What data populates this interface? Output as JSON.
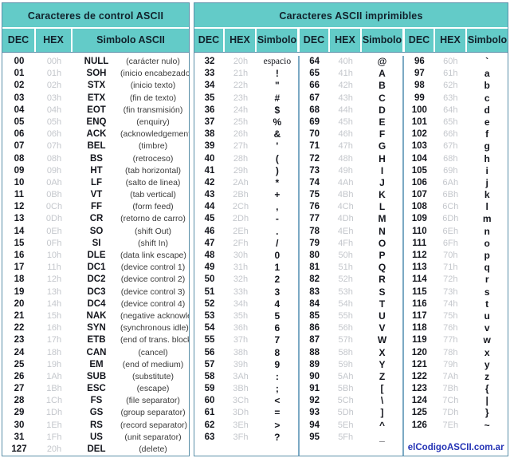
{
  "control_panel": {
    "title": "Caracteres de control ASCII",
    "headers": {
      "dec": "DEC",
      "hex": "HEX",
      "symbol": "Simbolo ASCII"
    },
    "rows": [
      {
        "dec": "00",
        "hex": "00h",
        "sym": "NULL",
        "desc": "(carácter nulo)"
      },
      {
        "dec": "01",
        "hex": "01h",
        "sym": "SOH",
        "desc": "(inicio encabezado)"
      },
      {
        "dec": "02",
        "hex": "02h",
        "sym": "STX",
        "desc": "(inicio texto)"
      },
      {
        "dec": "03",
        "hex": "03h",
        "sym": "ETX",
        "desc": "(fin de texto)"
      },
      {
        "dec": "04",
        "hex": "04h",
        "sym": "EOT",
        "desc": "(fin transmisión)"
      },
      {
        "dec": "05",
        "hex": "05h",
        "sym": "ENQ",
        "desc": "(enquiry)"
      },
      {
        "dec": "06",
        "hex": "06h",
        "sym": "ACK",
        "desc": "(acknowledgement)"
      },
      {
        "dec": "07",
        "hex": "07h",
        "sym": "BEL",
        "desc": "(timbre)"
      },
      {
        "dec": "08",
        "hex": "08h",
        "sym": "BS",
        "desc": "(retroceso)"
      },
      {
        "dec": "09",
        "hex": "09h",
        "sym": "HT",
        "desc": "(tab horizontal)"
      },
      {
        "dec": "10",
        "hex": "0Ah",
        "sym": "LF",
        "desc": "(salto de linea)"
      },
      {
        "dec": "11",
        "hex": "0Bh",
        "sym": "VT",
        "desc": "(tab vertical)"
      },
      {
        "dec": "12",
        "hex": "0Ch",
        "sym": "FF",
        "desc": "(form feed)"
      },
      {
        "dec": "13",
        "hex": "0Dh",
        "sym": "CR",
        "desc": "(retorno de carro)"
      },
      {
        "dec": "14",
        "hex": "0Eh",
        "sym": "SO",
        "desc": "(shift Out)"
      },
      {
        "dec": "15",
        "hex": "0Fh",
        "sym": "SI",
        "desc": "(shift In)"
      },
      {
        "dec": "16",
        "hex": "10h",
        "sym": "DLE",
        "desc": "(data link escape)"
      },
      {
        "dec": "17",
        "hex": "11h",
        "sym": "DC1",
        "desc": "(device control 1)"
      },
      {
        "dec": "18",
        "hex": "12h",
        "sym": "DC2",
        "desc": "(device control 2)"
      },
      {
        "dec": "19",
        "hex": "13h",
        "sym": "DC3",
        "desc": "(device control 3)"
      },
      {
        "dec": "20",
        "hex": "14h",
        "sym": "DC4",
        "desc": "(device control 4)"
      },
      {
        "dec": "21",
        "hex": "15h",
        "sym": "NAK",
        "desc": "(negative acknowle.)"
      },
      {
        "dec": "22",
        "hex": "16h",
        "sym": "SYN",
        "desc": "(synchronous idle)"
      },
      {
        "dec": "23",
        "hex": "17h",
        "sym": "ETB",
        "desc": "(end of trans. block)"
      },
      {
        "dec": "24",
        "hex": "18h",
        "sym": "CAN",
        "desc": "(cancel)"
      },
      {
        "dec": "25",
        "hex": "19h",
        "sym": "EM",
        "desc": "(end of medium)"
      },
      {
        "dec": "26",
        "hex": "1Ah",
        "sym": "SUB",
        "desc": "(substitute)"
      },
      {
        "dec": "27",
        "hex": "1Bh",
        "sym": "ESC",
        "desc": "(escape)"
      },
      {
        "dec": "28",
        "hex": "1Ch",
        "sym": "FS",
        "desc": "(file separator)"
      },
      {
        "dec": "29",
        "hex": "1Dh",
        "sym": "GS",
        "desc": "(group separator)"
      },
      {
        "dec": "30",
        "hex": "1Eh",
        "sym": "RS",
        "desc": "(record separator)"
      },
      {
        "dec": "31",
        "hex": "1Fh",
        "sym": "US",
        "desc": "(unit separator)"
      },
      {
        "dec": "127",
        "hex": "20h",
        "sym": "DEL",
        "desc": "(delete)"
      }
    ]
  },
  "printable_panel": {
    "title": "Caracteres ASCII imprimibles",
    "headers": {
      "dec": "DEC",
      "hex": "HEX",
      "symbol": "Simbolo"
    },
    "footer_link": "elCodigoASCII.com.ar",
    "columns": [
      [
        {
          "dec": "32",
          "hex": "20h",
          "sym": "espacio",
          "word": true
        },
        {
          "dec": "33",
          "hex": "21h",
          "sym": "!"
        },
        {
          "dec": "34",
          "hex": "22h",
          "sym": "\""
        },
        {
          "dec": "35",
          "hex": "23h",
          "sym": "#"
        },
        {
          "dec": "36",
          "hex": "24h",
          "sym": "$"
        },
        {
          "dec": "37",
          "hex": "25h",
          "sym": "%"
        },
        {
          "dec": "38",
          "hex": "26h",
          "sym": "&"
        },
        {
          "dec": "39",
          "hex": "27h",
          "sym": "'"
        },
        {
          "dec": "40",
          "hex": "28h",
          "sym": "("
        },
        {
          "dec": "41",
          "hex": "29h",
          "sym": ")"
        },
        {
          "dec": "42",
          "hex": "2Ah",
          "sym": "*"
        },
        {
          "dec": "43",
          "hex": "2Bh",
          "sym": "+"
        },
        {
          "dec": "44",
          "hex": "2Ch",
          "sym": ","
        },
        {
          "dec": "45",
          "hex": "2Dh",
          "sym": "-"
        },
        {
          "dec": "46",
          "hex": "2Eh",
          "sym": "."
        },
        {
          "dec": "47",
          "hex": "2Fh",
          "sym": "/"
        },
        {
          "dec": "48",
          "hex": "30h",
          "sym": "0"
        },
        {
          "dec": "49",
          "hex": "31h",
          "sym": "1"
        },
        {
          "dec": "50",
          "hex": "32h",
          "sym": "2"
        },
        {
          "dec": "51",
          "hex": "33h",
          "sym": "3"
        },
        {
          "dec": "52",
          "hex": "34h",
          "sym": "4"
        },
        {
          "dec": "53",
          "hex": "35h",
          "sym": "5"
        },
        {
          "dec": "54",
          "hex": "36h",
          "sym": "6"
        },
        {
          "dec": "55",
          "hex": "37h",
          "sym": "7"
        },
        {
          "dec": "56",
          "hex": "38h",
          "sym": "8"
        },
        {
          "dec": "57",
          "hex": "39h",
          "sym": "9"
        },
        {
          "dec": "58",
          "hex": "3Ah",
          "sym": ":"
        },
        {
          "dec": "59",
          "hex": "3Bh",
          "sym": ";"
        },
        {
          "dec": "60",
          "hex": "3Ch",
          "sym": "<"
        },
        {
          "dec": "61",
          "hex": "3Dh",
          "sym": "="
        },
        {
          "dec": "62",
          "hex": "3Eh",
          "sym": ">"
        },
        {
          "dec": "63",
          "hex": "3Fh",
          "sym": "?"
        }
      ],
      [
        {
          "dec": "64",
          "hex": "40h",
          "sym": "@"
        },
        {
          "dec": "65",
          "hex": "41h",
          "sym": "A"
        },
        {
          "dec": "66",
          "hex": "42h",
          "sym": "B"
        },
        {
          "dec": "67",
          "hex": "43h",
          "sym": "C"
        },
        {
          "dec": "68",
          "hex": "44h",
          "sym": "D"
        },
        {
          "dec": "69",
          "hex": "45h",
          "sym": "E"
        },
        {
          "dec": "70",
          "hex": "46h",
          "sym": "F"
        },
        {
          "dec": "71",
          "hex": "47h",
          "sym": "G"
        },
        {
          "dec": "72",
          "hex": "48h",
          "sym": "H"
        },
        {
          "dec": "73",
          "hex": "49h",
          "sym": "I"
        },
        {
          "dec": "74",
          "hex": "4Ah",
          "sym": "J"
        },
        {
          "dec": "75",
          "hex": "4Bh",
          "sym": "K"
        },
        {
          "dec": "76",
          "hex": "4Ch",
          "sym": "L"
        },
        {
          "dec": "77",
          "hex": "4Dh",
          "sym": "M"
        },
        {
          "dec": "78",
          "hex": "4Eh",
          "sym": "N"
        },
        {
          "dec": "79",
          "hex": "4Fh",
          "sym": "O"
        },
        {
          "dec": "80",
          "hex": "50h",
          "sym": "P"
        },
        {
          "dec": "81",
          "hex": "51h",
          "sym": "Q"
        },
        {
          "dec": "82",
          "hex": "52h",
          "sym": "R"
        },
        {
          "dec": "83",
          "hex": "53h",
          "sym": "S"
        },
        {
          "dec": "84",
          "hex": "54h",
          "sym": "T"
        },
        {
          "dec": "85",
          "hex": "55h",
          "sym": "U"
        },
        {
          "dec": "86",
          "hex": "56h",
          "sym": "V"
        },
        {
          "dec": "87",
          "hex": "57h",
          "sym": "W"
        },
        {
          "dec": "88",
          "hex": "58h",
          "sym": "X"
        },
        {
          "dec": "89",
          "hex": "59h",
          "sym": "Y"
        },
        {
          "dec": "90",
          "hex": "5Ah",
          "sym": "Z"
        },
        {
          "dec": "91",
          "hex": "5Bh",
          "sym": "["
        },
        {
          "dec": "92",
          "hex": "5Ch",
          "sym": "\\"
        },
        {
          "dec": "93",
          "hex": "5Dh",
          "sym": "]"
        },
        {
          "dec": "94",
          "hex": "5Eh",
          "sym": "^"
        },
        {
          "dec": "95",
          "hex": "5Fh",
          "sym": "_"
        }
      ],
      [
        {
          "dec": "96",
          "hex": "60h",
          "sym": "`"
        },
        {
          "dec": "97",
          "hex": "61h",
          "sym": "a"
        },
        {
          "dec": "98",
          "hex": "62h",
          "sym": "b"
        },
        {
          "dec": "99",
          "hex": "63h",
          "sym": "c"
        },
        {
          "dec": "100",
          "hex": "64h",
          "sym": "d"
        },
        {
          "dec": "101",
          "hex": "65h",
          "sym": "e"
        },
        {
          "dec": "102",
          "hex": "66h",
          "sym": "f"
        },
        {
          "dec": "103",
          "hex": "67h",
          "sym": "g"
        },
        {
          "dec": "104",
          "hex": "68h",
          "sym": "h"
        },
        {
          "dec": "105",
          "hex": "69h",
          "sym": "i"
        },
        {
          "dec": "106",
          "hex": "6Ah",
          "sym": "j"
        },
        {
          "dec": "107",
          "hex": "6Bh",
          "sym": "k"
        },
        {
          "dec": "108",
          "hex": "6Ch",
          "sym": "l"
        },
        {
          "dec": "109",
          "hex": "6Dh",
          "sym": "m"
        },
        {
          "dec": "110",
          "hex": "6Eh",
          "sym": "n"
        },
        {
          "dec": "111",
          "hex": "6Fh",
          "sym": "o"
        },
        {
          "dec": "112",
          "hex": "70h",
          "sym": "p"
        },
        {
          "dec": "113",
          "hex": "71h",
          "sym": "q"
        },
        {
          "dec": "114",
          "hex": "72h",
          "sym": "r"
        },
        {
          "dec": "115",
          "hex": "73h",
          "sym": "s"
        },
        {
          "dec": "116",
          "hex": "74h",
          "sym": "t"
        },
        {
          "dec": "117",
          "hex": "75h",
          "sym": "u"
        },
        {
          "dec": "118",
          "hex": "76h",
          "sym": "v"
        },
        {
          "dec": "119",
          "hex": "77h",
          "sym": "w"
        },
        {
          "dec": "120",
          "hex": "78h",
          "sym": "x"
        },
        {
          "dec": "121",
          "hex": "79h",
          "sym": "y"
        },
        {
          "dec": "122",
          "hex": "7Ah",
          "sym": "z"
        },
        {
          "dec": "123",
          "hex": "7Bh",
          "sym": "{"
        },
        {
          "dec": "124",
          "hex": "7Ch",
          "sym": "|"
        },
        {
          "dec": "125",
          "hex": "7Dh",
          "sym": "}"
        },
        {
          "dec": "126",
          "hex": "7Eh",
          "sym": "~"
        }
      ]
    ]
  },
  "colors": {
    "header_teal": "#63cbc8",
    "border_blue": "#5a8fa8",
    "hex_gray": "#c4c7cc",
    "link_blue": "#2433b5",
    "text_dark": "#14161d"
  }
}
